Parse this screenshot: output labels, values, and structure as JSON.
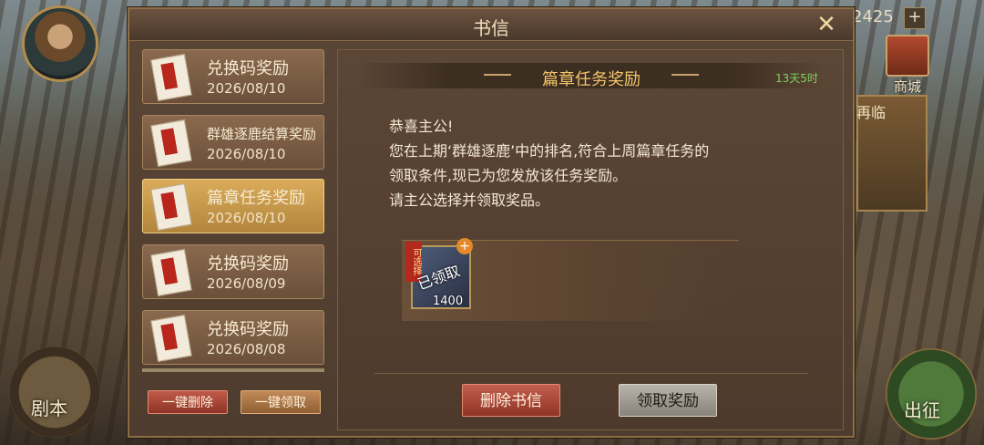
{
  "hud": {
    "counter_value": "2425",
    "plus_symbol": "+",
    "shop_label": "商城",
    "side_event_label": "再临",
    "script_label": "剧本",
    "march_label": "出征"
  },
  "dialog": {
    "title": "书信",
    "close_symbol": "✕",
    "mail_list": [
      {
        "title": "兑换码奖励",
        "date": "2026/08/10"
      },
      {
        "title": "群雄逐鹿结算奖励",
        "date": "2026/08/10"
      },
      {
        "title": "篇章任务奖励",
        "date": "2026/08/10",
        "selected": true
      },
      {
        "title": "兑换码奖励",
        "date": "2026/08/09"
      },
      {
        "title": "兑换码奖励",
        "date": "2026/08/08"
      }
    ],
    "delete_all_label": "一键删除",
    "claim_all_label": "一键领取",
    "content": {
      "title": "篇章任务奖励",
      "timer": "13天5时",
      "body_lines": [
        "恭喜主公!",
        "您在上期‘群雄逐鹿’中的排名,符合上周篇章任务的",
        "领取条件,现已为您发放该任务奖励。",
        "请主公选择并领取奖品。"
      ],
      "reward": {
        "optional_tag": "可选择",
        "claimed_stamp": "已领取",
        "quantity": "1400",
        "plus_symbol": "+"
      },
      "delete_mail_label": "删除书信",
      "claim_label": "领取奖励"
    }
  }
}
